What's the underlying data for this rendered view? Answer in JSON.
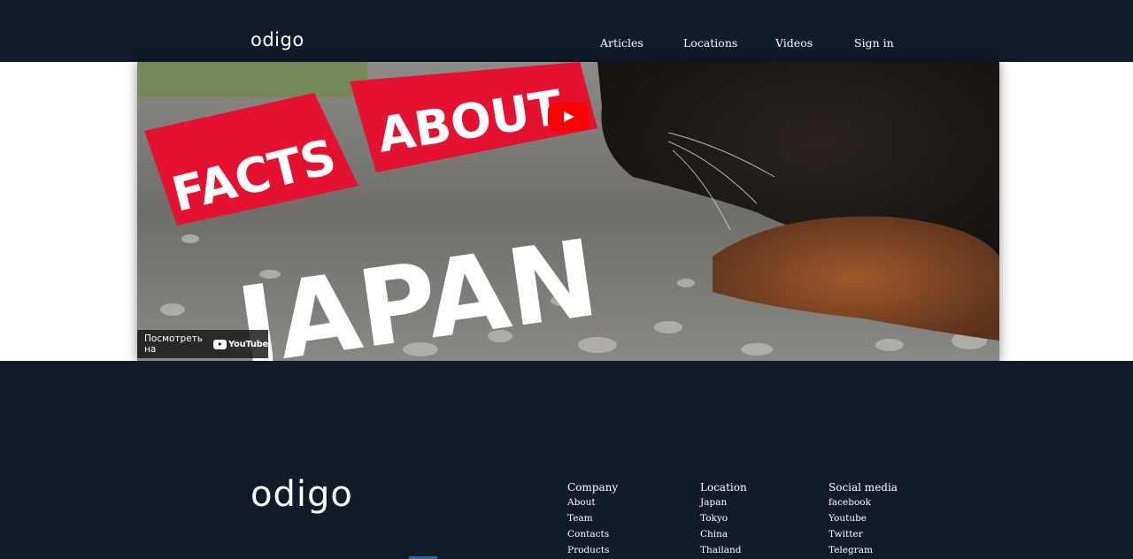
{
  "header": {
    "logo": "odigo",
    "nav": {
      "articles": "Articles",
      "locations": "Locations",
      "videos": "Videos",
      "signin": "Sign in"
    }
  },
  "video": {
    "thumbnail_text": {
      "line1": "FACTS",
      "line2": "ABOUT",
      "line3": "JAPAN"
    },
    "watch_on": "Посмотреть на",
    "youtube_label": "YouTube",
    "colors": {
      "play": "#ff0000",
      "banner": "#e41130"
    }
  },
  "footer": {
    "logo": "odigo",
    "company": {
      "title": "Company",
      "items": [
        "About",
        "Team",
        "Contacts",
        "Products"
      ]
    },
    "location": {
      "title": "Location",
      "items": [
        "Japan",
        "Tokyo",
        "China",
        "Thailand"
      ]
    },
    "social": {
      "title": "Social media",
      "items": [
        "facebook",
        "Youtube",
        "Twitter",
        "Telegram"
      ]
    }
  },
  "colors": {
    "dark_bg": "#111b29",
    "text": "#ffffff"
  }
}
